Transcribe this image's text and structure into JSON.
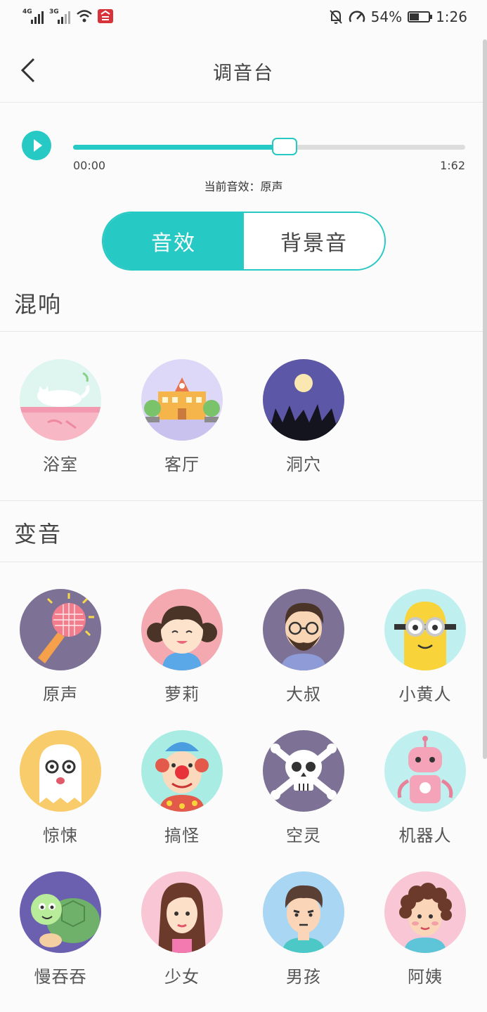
{
  "status_bar": {
    "net1": "4G",
    "net2": "3G",
    "battery_text": "54%",
    "battery_level": 0.54,
    "time": "1:26",
    "icons": [
      "signal-4g-icon",
      "signal-3g-icon",
      "wifi-icon",
      "app-notification-icon",
      "mute-bell-icon",
      "speed-icon",
      "battery-icon"
    ]
  },
  "header": {
    "title": "调音台",
    "back_icon": "chevron-left-icon"
  },
  "player": {
    "play_icon": "play-icon",
    "progress": 0.54,
    "time_start": "00:00",
    "time_end": "1:62",
    "current_effect_label": "当前音效：",
    "current_effect_value": "原声"
  },
  "tabs": [
    {
      "label": "音效",
      "active": true
    },
    {
      "label": "背景音",
      "active": false
    }
  ],
  "reverb": {
    "title": "混响",
    "items": [
      {
        "label": "浴室",
        "icon": "bathroom-cat-icon"
      },
      {
        "label": "客厅",
        "icon": "living-room-building-icon"
      },
      {
        "label": "洞穴",
        "icon": "cave-moon-icon"
      }
    ]
  },
  "voice_change": {
    "title": "变音",
    "items": [
      {
        "label": "原声",
        "icon": "microphone-icon"
      },
      {
        "label": "萝莉",
        "icon": "girl-pigtails-icon"
      },
      {
        "label": "大叔",
        "icon": "bearded-man-icon"
      },
      {
        "label": "小黄人",
        "icon": "minion-icon"
      },
      {
        "label": "惊悚",
        "icon": "ghost-icon"
      },
      {
        "label": "搞怪",
        "icon": "clown-icon"
      },
      {
        "label": "空灵",
        "icon": "skull-icon"
      },
      {
        "label": "机器人",
        "icon": "robot-icon"
      },
      {
        "label": "慢吞吞",
        "icon": "turtle-icon"
      },
      {
        "label": "少女",
        "icon": "young-woman-icon"
      },
      {
        "label": "男孩",
        "icon": "boy-icon"
      },
      {
        "label": "阿姨",
        "icon": "auntie-icon"
      }
    ]
  },
  "colors": {
    "accent": "#27c9c4",
    "text": "#444444",
    "divider": "#e6e6e6"
  }
}
